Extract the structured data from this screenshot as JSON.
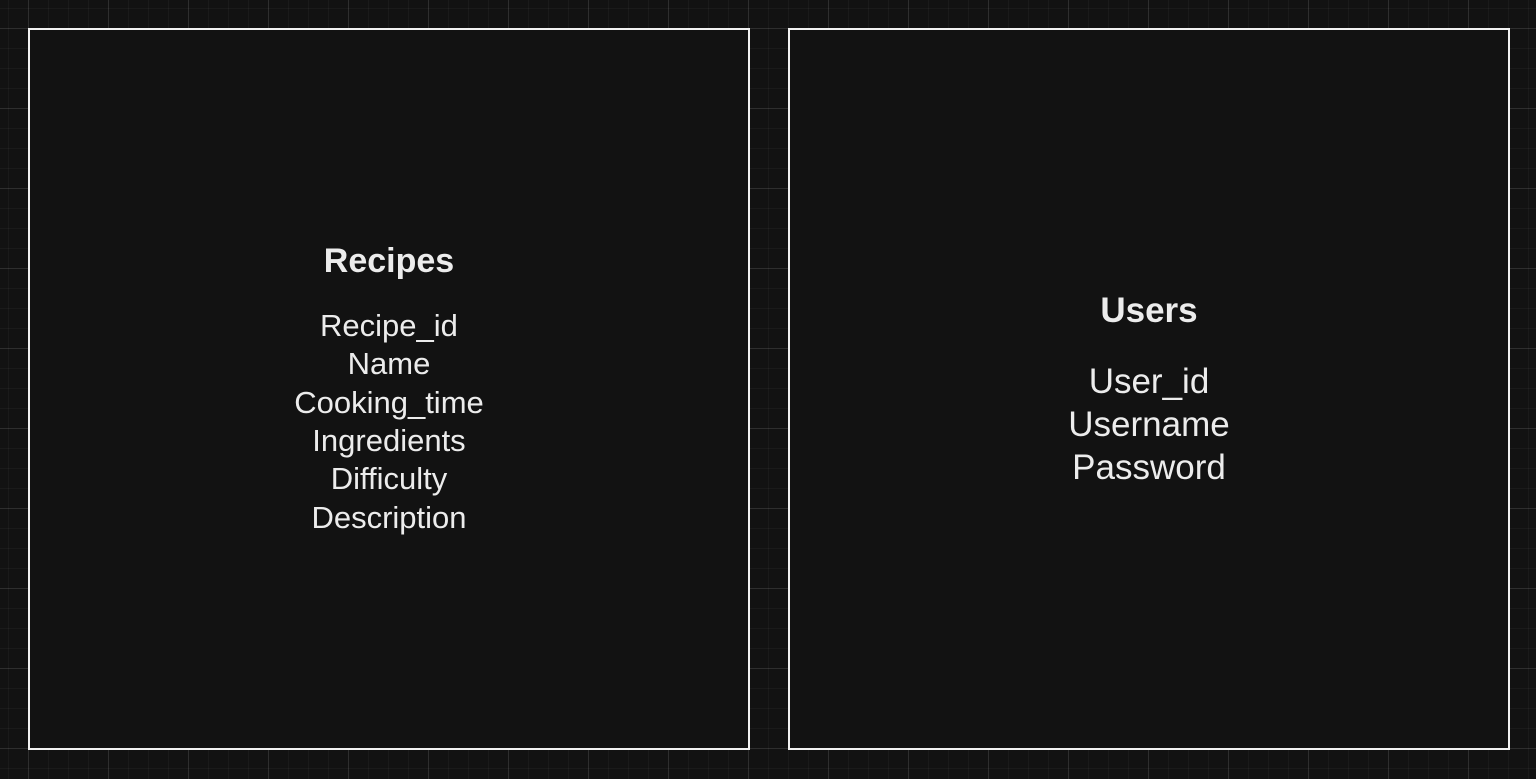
{
  "colors": {
    "background": "#121212",
    "grid_line": "#2a2a2a",
    "box_border": "#f2f2f2",
    "text": "#ececec"
  },
  "entities": [
    {
      "title": "Recipes",
      "attributes": [
        "Recipe_id",
        "Name",
        "Cooking_time",
        "Ingredients",
        "Difficulty",
        "Description"
      ]
    },
    {
      "title": "Users",
      "attributes": [
        "User_id",
        "Username",
        "Password"
      ]
    }
  ]
}
